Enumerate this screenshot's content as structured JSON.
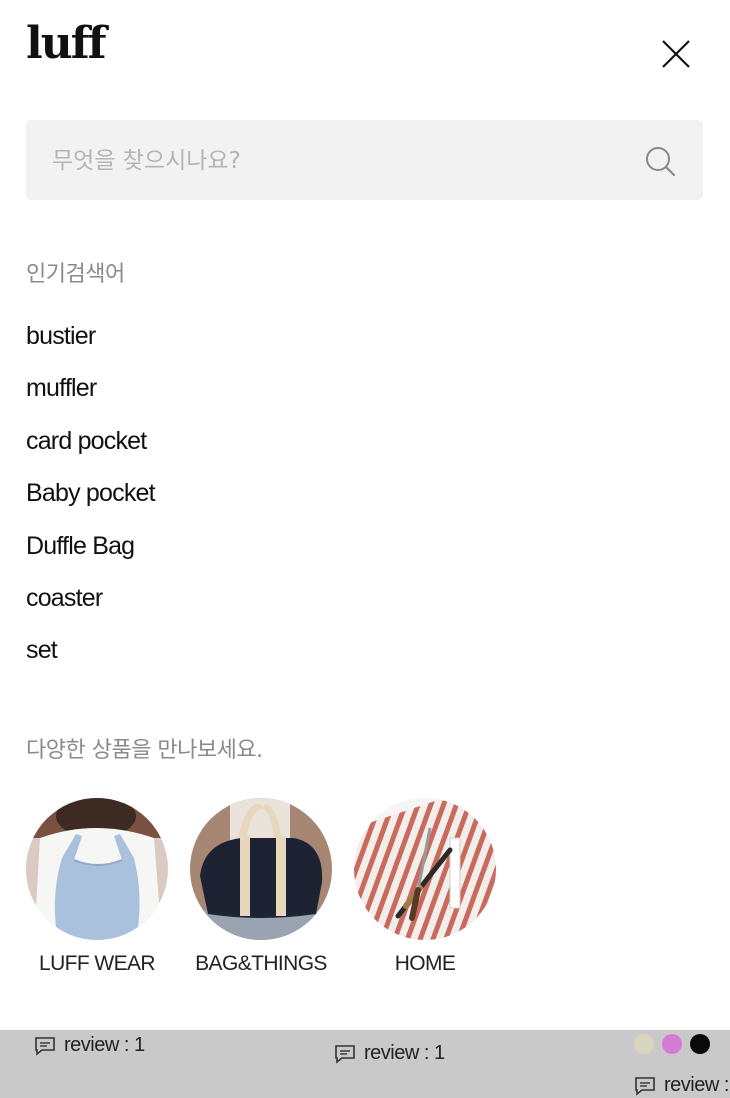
{
  "header": {
    "logo_text": "luff"
  },
  "search": {
    "placeholder": "무엇을 찾으시나요?"
  },
  "popular": {
    "title": "인기검색어",
    "keywords": [
      "bustier",
      "muffler",
      "card pocket",
      "Baby pocket",
      "Duffle Bag",
      "coaster",
      "set"
    ]
  },
  "categories": {
    "title": "다양한 상품을 만나보세요.",
    "items": [
      {
        "label": "LUFF WEAR"
      },
      {
        "label": "BAG&THINGS"
      },
      {
        "label": "HOME"
      }
    ]
  },
  "bottom": {
    "reviews": [
      "review : 1",
      "review : 1",
      "review :"
    ],
    "swatch_colors": [
      "#d9d4bd",
      "#d57ad2",
      "#0a0a0a"
    ]
  },
  "colors": {
    "search_bg": "#f2f2f2",
    "section_title": "#8a8a8a",
    "bottom_strip": "#c9c9c9"
  }
}
